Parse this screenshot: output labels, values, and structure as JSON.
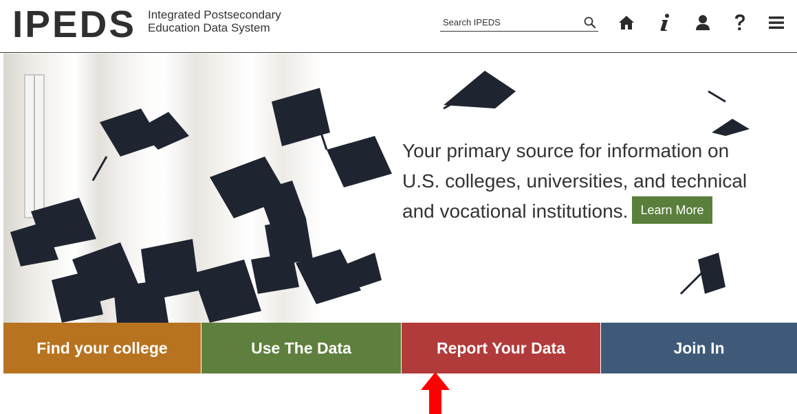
{
  "header": {
    "logo_text": "IPEDS",
    "logo_line1": "Integrated Postsecondary",
    "logo_line2": "Education Data System",
    "search_placeholder": "Search IPEDS",
    "nav_icons": [
      "home-icon",
      "info-icon",
      "user-icon",
      "help-icon",
      "menu-icon"
    ]
  },
  "hero": {
    "line1": "Your primary source for information on",
    "line2": "U.S. colleges, universities, and technical",
    "line3": "and vocational institutions.",
    "learn_more_label": "Learn More"
  },
  "tiles": [
    {
      "label": "Find your college",
      "color": "#b87320"
    },
    {
      "label": "Use The Data",
      "color": "#5e7f3d"
    },
    {
      "label": "Report Your Data",
      "color": "#b13b3a"
    },
    {
      "label": "Join In",
      "color": "#3e5a78"
    }
  ],
  "colors": {
    "learn_more": "#5a7f3c",
    "arrow": "#ff0000"
  }
}
